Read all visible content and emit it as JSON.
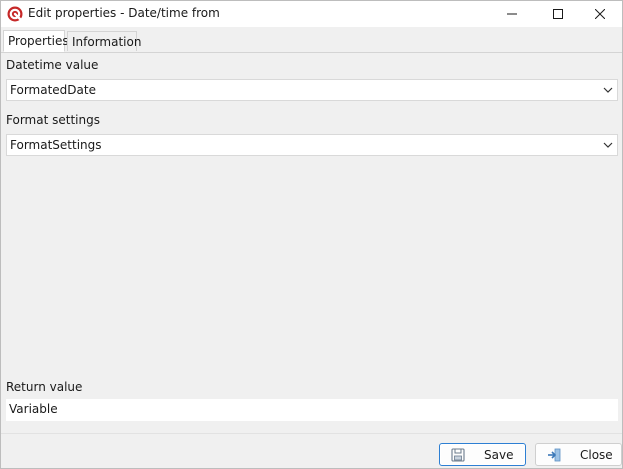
{
  "window": {
    "title": "Edit properties - Date/time from"
  },
  "tabs": [
    {
      "label": "Properties",
      "active": true
    },
    {
      "label": "Information",
      "active": false
    }
  ],
  "fields": {
    "datetime_value": {
      "label": "Datetime value",
      "value": "FormatedDate"
    },
    "format_settings": {
      "label": "Format settings",
      "value": "FormatSettings"
    },
    "return_value": {
      "label": "Return value",
      "value": "Variable"
    }
  },
  "buttons": {
    "save": {
      "label": "Save",
      "icon": "floppy-disk-icon"
    },
    "close": {
      "label": "Close",
      "icon": "exit-arrow-icon"
    }
  },
  "colors": {
    "accent": "#2d7fd3",
    "app_icon": "#c62828",
    "background": "#f0f0f0"
  }
}
